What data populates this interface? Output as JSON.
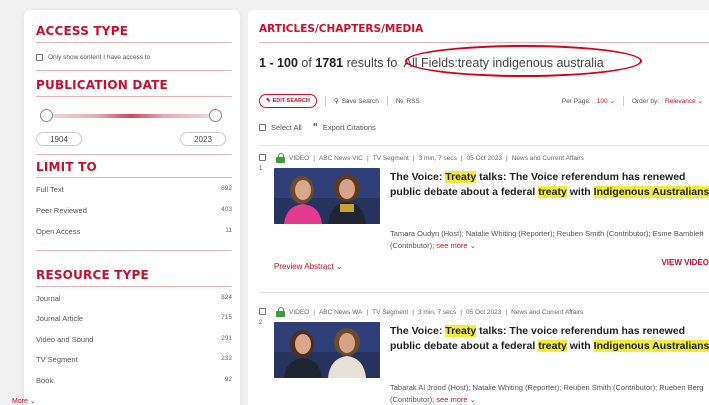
{
  "sidebar": {
    "access_type": {
      "title": "ACCESS TYPE",
      "checkbox_label": "Only show content I have access to"
    },
    "publication_date": {
      "title": "PUBLICATION DATE",
      "from": "1904",
      "to": "2023"
    },
    "limit_to": {
      "title": "LIMIT TO",
      "items": [
        {
          "label": "Full Text",
          "count": "892"
        },
        {
          "label": "Peer Reviewed",
          "count": "403"
        },
        {
          "label": "Open Access",
          "count": "11"
        }
      ]
    },
    "resource_type": {
      "title": "RESOURCE TYPE",
      "items": [
        {
          "label": "Journal",
          "count": "824"
        },
        {
          "label": "Journal Article",
          "count": "715"
        },
        {
          "label": "Video and Sound",
          "count": "291"
        },
        {
          "label": "TV Segment",
          "count": "232"
        },
        {
          "label": "Book",
          "count": "92"
        }
      ],
      "more": "More"
    }
  },
  "main": {
    "tab": "ARTICLES/CHAPTERS/MEDIA",
    "results": {
      "range": "1 - 100",
      "of": "of",
      "total": "1781",
      "suffix": "results fo",
      "query": "All Fields:treaty indigenous australia"
    },
    "toolbar": {
      "edit_search": "EDIT SEARCH",
      "save_search": "Save Search",
      "rss": "RSS",
      "per_page_label": "Per Page:",
      "per_page_value": "100",
      "order_label": "Order by:",
      "order_value": "Relevance"
    },
    "select_all": "Select All",
    "export": "Export Citations",
    "items": [
      {
        "number": "1",
        "type": "VIDEO",
        "source": "ABC News VIC",
        "format": "TV Segment",
        "duration": "3 min, 7 secs",
        "date": "05 Oct 2023",
        "category": "News and Current Affairs",
        "title_parts": [
          "The Voice: ",
          "Treaty",
          " talks: The Voice referendum has renewed public debate about a federal ",
          "treaty",
          " with ",
          "Indigenous Australians",
          "."
        ],
        "contributors": "Tamara Oudyn (Host); Natalie Whiting (Reporter); Reuben Smith (Contributor); Esme Bamblett (Contributor);",
        "see_more": "see more",
        "preview": "Preview Abstract",
        "view": "VIEW VIDEO"
      },
      {
        "number": "2",
        "type": "VIDEO",
        "source": "ABC News WA",
        "format": "TV Segment",
        "duration": "3 min, 7 secs",
        "date": "05 Oct 2023",
        "category": "News and Current Affairs",
        "title_parts": [
          "The Voice: ",
          "Treaty",
          " talks: The voice referendum has renewed public debate about a federal ",
          "treaty",
          " with ",
          "Indigenous Australians",
          "."
        ],
        "contributors": "Tabarak Al Jrood (Host); Natalie Whiting (Reporter); Reuben Smith (Contributor); Rueben Berg (Contributor);",
        "see_more": "see more"
      }
    ]
  },
  "colors": {
    "accent": "#c8102e",
    "highlight": "#f3ec3a",
    "access_green": "#3a9c3a",
    "annotation_oval": "#d6001c"
  }
}
